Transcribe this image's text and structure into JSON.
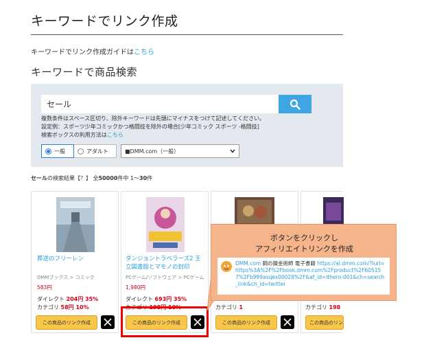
{
  "page": {
    "title": "キーワードでリンク作成",
    "guide_prefix": "キーワードでリンク作成ガイドは",
    "guide_link": "こちら",
    "subtitle": "キーワードで商品検索"
  },
  "search": {
    "value": "セール",
    "help_line1": "複数条件はスペース区切り、除外キーワードは先頭にマイナスをつけて記述してください。",
    "help_line2": "設定例：スポーツ少年コミックかつ格闘技を除外の場合[少年コミック スポーツ -格闘技]",
    "help_line3_prefix": "検索ボックスの利用方法は",
    "help_line3_link": "こちら",
    "radio_general": "一般",
    "radio_adult": "アダルト",
    "select_value": "■DMM.com（一般）"
  },
  "results": {
    "keyword": "セール",
    "rest": "の検索結果【？】 全",
    "total": "50000",
    "range": "件中 1〜",
    "end": "30",
    "suffix": "件"
  },
  "products": [
    {
      "title": "葬送のフリーレン",
      "category": "DMMブックス > コミック",
      "price": "583円",
      "direct_label": "ダイレクト",
      "direct_value": "204円 35%",
      "cat_label": "カテゴリ",
      "cat_value": "58円 10%",
      "button": "この商品のリンク作成"
    },
    {
      "title": "ダンジョントラベラーズ2 王立図書館とマモノの封印",
      "category": "PCゲーム/ソフトウェア > PCゲーム",
      "price": "1,980円",
      "direct_label": "ダイレクト",
      "direct_value": "693円 35%",
      "cat_label": "カテゴリ",
      "cat_value": "198円 10%",
      "button": "この商品のリンク作成"
    },
    {
      "cat_label": "カテゴリ",
      "cat_value": "1",
      "button": "この商品のリンク作成"
    },
    {
      "cat_label": "カテゴリ",
      "cat_value": "198",
      "button": "この商品のリンク作成"
    }
  ],
  "callout": {
    "line1": "ボタンをクリックし",
    "line2": "アフィリエイトリンクを作成",
    "tweet_source": "DMM.com",
    "tweet_title": " 鋼の錬金術師 電子書籍 ",
    "tweet_url": "https://al.dmm.com/?lurl=https%3A%2F%2Fbook.dmm.com%2Fproduct%2F605157%2Fb999asqex00028%2F&af_id=ithero-001&ch=search_link&ch_id=twitter"
  },
  "colors": {
    "accent_blue": "#3fa6e3",
    "link_blue": "#2a9fd6",
    "price_red": "#d0021b",
    "button_yellow": "#f8c74a",
    "highlight_red": "#ee0000",
    "callout_orange": "#f6b48b"
  },
  "icons": {
    "search": "search-icon",
    "x_logo": "x-logo-icon",
    "dropdown": "chevron-down-icon"
  }
}
